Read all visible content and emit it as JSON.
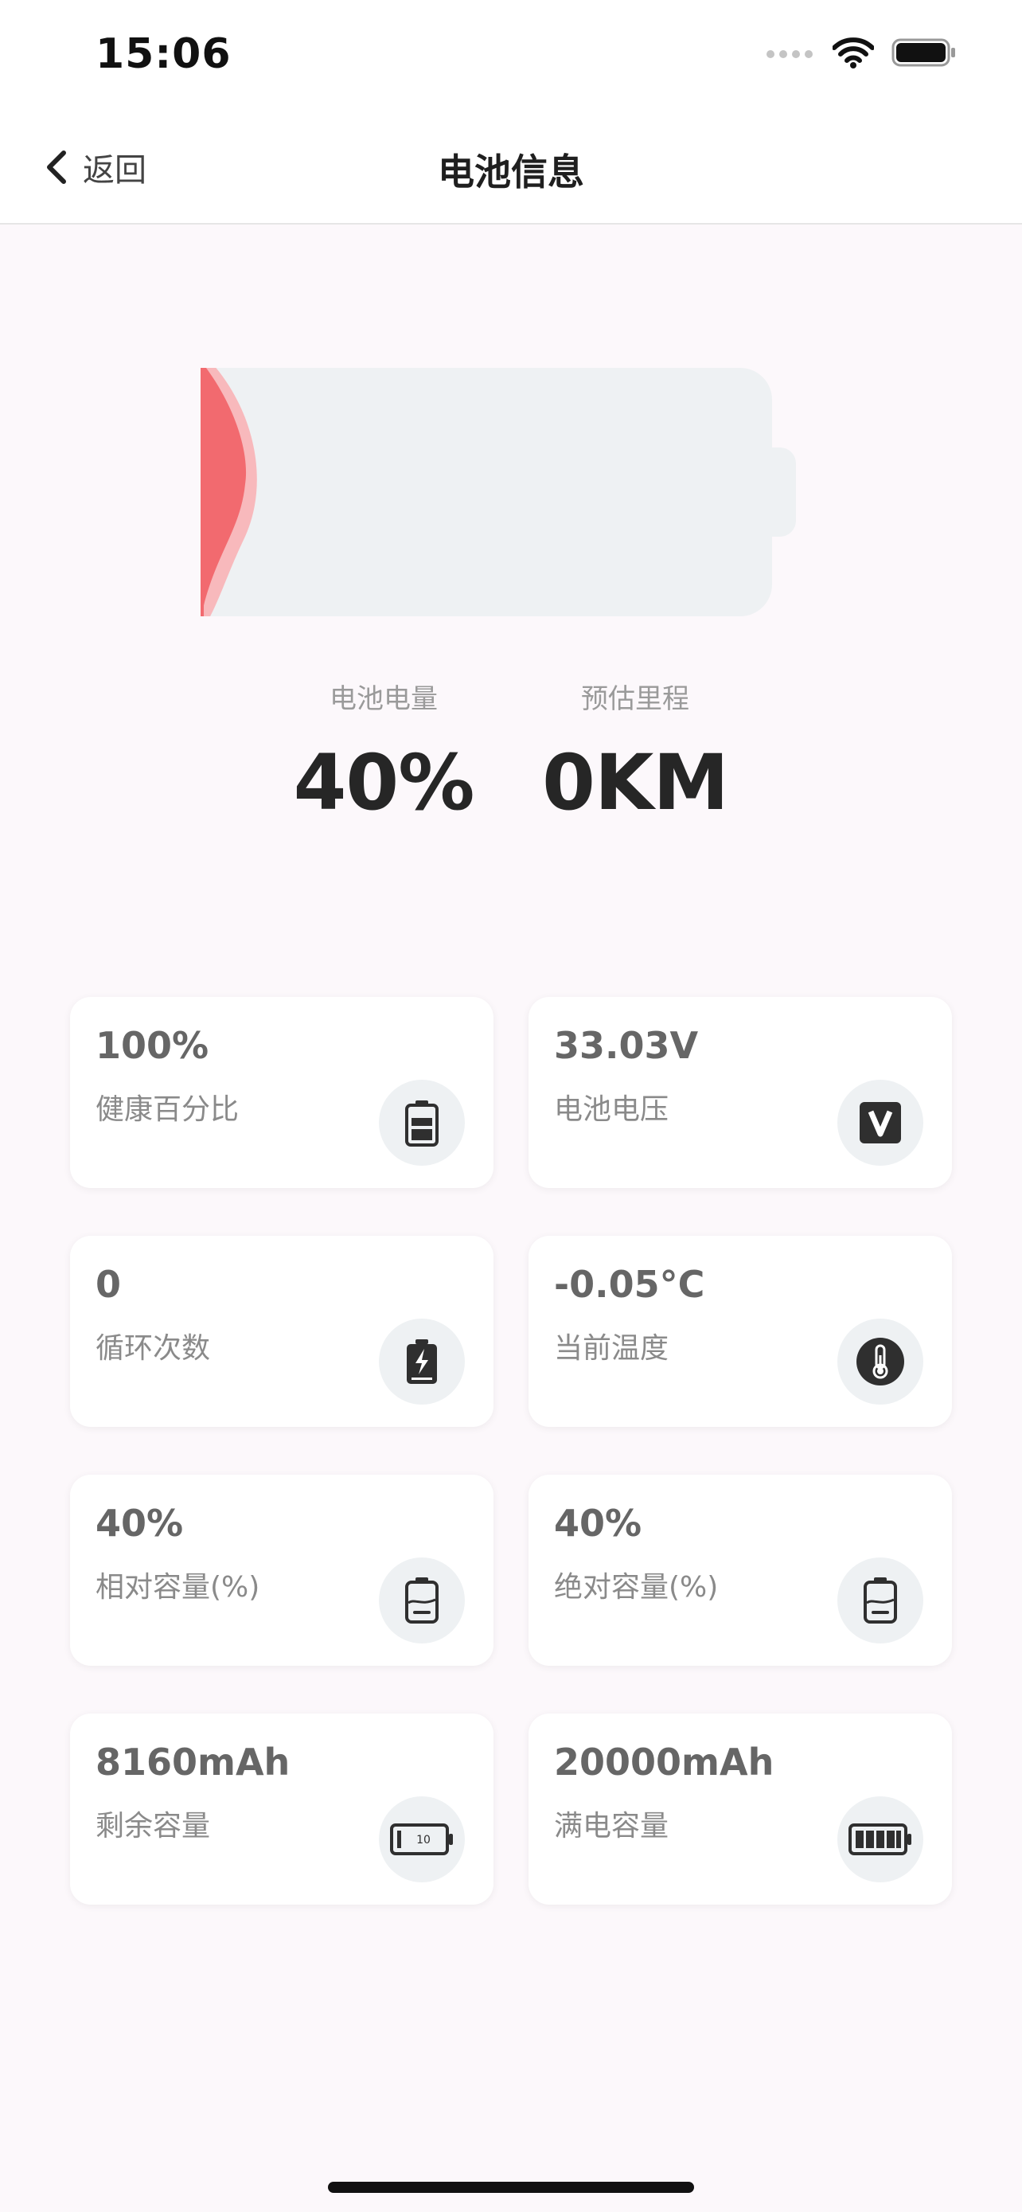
{
  "status_bar": {
    "time": "15:06"
  },
  "nav": {
    "back_label": "返回",
    "title": "电池信息"
  },
  "battery": {
    "level_percent": 40,
    "colors": {
      "body": "#eef1f3",
      "wave_front": "#f26a6f",
      "wave_back": "#f8b9bc"
    }
  },
  "stats": {
    "charge_label": "电池电量",
    "charge_value": "40%",
    "range_label": "预估里程",
    "range_value": "0KM"
  },
  "cards": [
    {
      "value": "100%",
      "label": "健康百分比",
      "icon": "battery-health-icon"
    },
    {
      "value": "33.03V",
      "label": "电池电压",
      "icon": "voltage-icon"
    },
    {
      "value": "0",
      "label": "循环次数",
      "icon": "battery-charging-icon"
    },
    {
      "value": "-0.05°C",
      "label": "当前温度",
      "icon": "thermometer-icon"
    },
    {
      "value": "40%",
      "label": "相对容量(%)",
      "icon": "battery-relative-icon"
    },
    {
      "value": "40%",
      "label": "绝对容量(%)",
      "icon": "battery-absolute-icon"
    },
    {
      "value": "8160mAh",
      "label": "剩余容量",
      "icon": "battery-remaining-icon",
      "icon_text": "10"
    },
    {
      "value": "20000mAh",
      "label": "满电容量",
      "icon": "battery-full-icon"
    }
  ]
}
